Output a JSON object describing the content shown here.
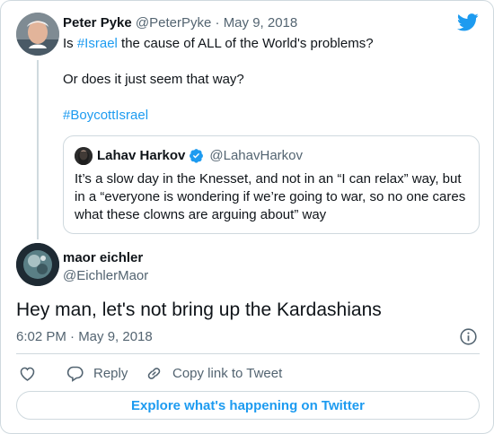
{
  "parent_tweet": {
    "author_name": "Peter Pyke",
    "author_handle": "@PeterPyke",
    "separator": "·",
    "date": "May 9, 2018",
    "line1_before": "Is ",
    "line1_hashtag": "#Israel",
    "line1_after": " the cause of ALL of the World's problems?",
    "line2": "Or does it just seem that way?",
    "hashtag2": "#BoycottIsrael"
  },
  "quote_tweet": {
    "author_name": "Lahav Harkov",
    "author_handle": "@LahavHarkov",
    "text": "It’s a slow day in the Knesset, and not in an “I can relax” way, but in a “everyone is wondering if we’re going to war, so no one cares what these clowns are arguing about” way"
  },
  "reply_tweet": {
    "author_name": "maor eichler",
    "author_handle": "@EichlerMaor",
    "text": "Hey man, let's not bring up the Kardashians",
    "timestamp": "6:02 PM · May 9, 2018"
  },
  "actions": {
    "reply_label": "Reply",
    "copy_label": "Copy link to Tweet"
  },
  "explore_button_label": "Explore what's happening on Twitter",
  "colors": {
    "brand_blue": "#1d9bf0",
    "text_primary": "#0f1419",
    "text_secondary": "#536471",
    "border": "#cfd9de"
  },
  "icons": {
    "logo": "twitter-bird-icon",
    "verified": "verified-badge-icon",
    "info": "info-icon",
    "like": "heart-icon",
    "reply": "speech-bubble-icon",
    "copy": "link-icon"
  }
}
